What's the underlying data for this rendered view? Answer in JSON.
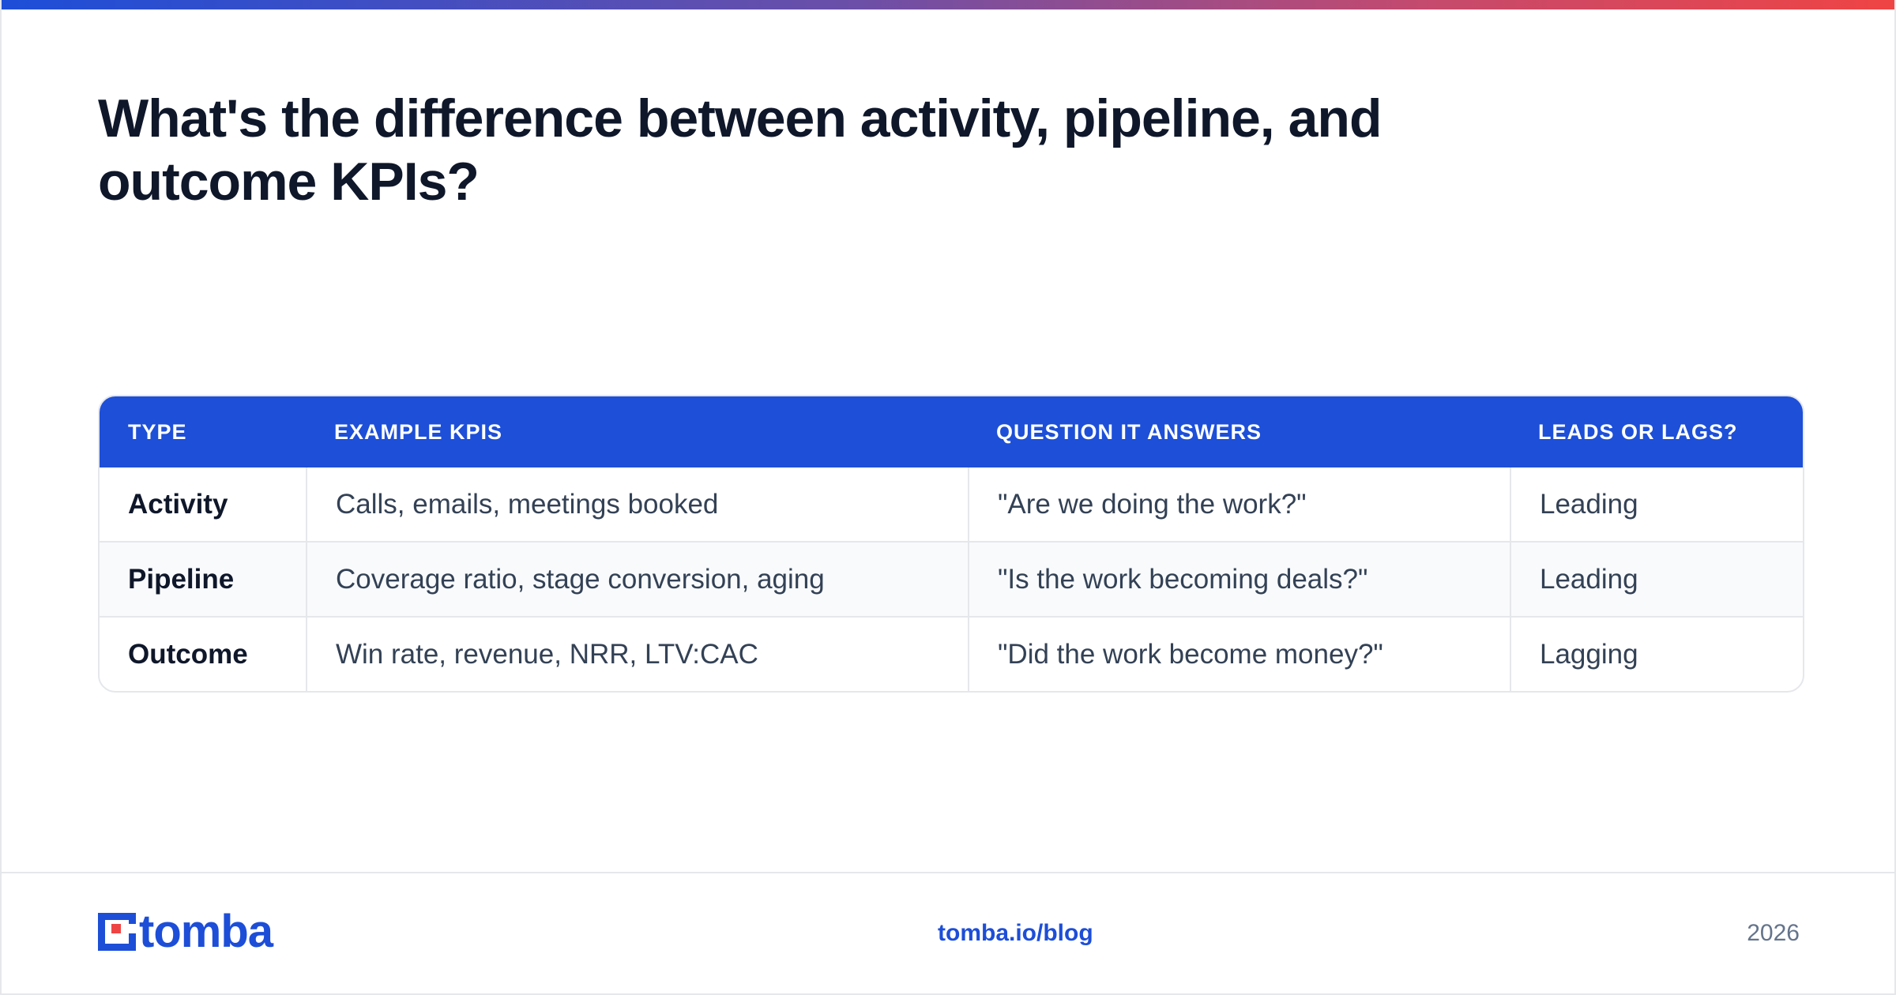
{
  "title": "What's the difference between activity, pipeline, and outcome KPIs?",
  "table": {
    "headers": [
      "TYPE",
      "EXAMPLE KPIS",
      "QUESTION IT ANSWERS",
      "LEADS OR LAGS?"
    ],
    "rows": [
      [
        "Activity",
        "Calls, emails, meetings booked",
        "\"Are we doing the work?\"",
        "Leading"
      ],
      [
        "Pipeline",
        "Coverage ratio, stage conversion, aging",
        "\"Is the work becoming deals?\"",
        "Leading"
      ],
      [
        "Outcome",
        "Win rate, revenue, NRR, LTV:CAC",
        "\"Did the work become money?\"",
        "Lagging"
      ]
    ]
  },
  "footer": {
    "logo_text": "tomba",
    "link": "tomba.io/blog",
    "year": "2026"
  },
  "colors": {
    "brand_blue": "#1d4ed8",
    "brand_red": "#ef4444",
    "title": "#0f172a",
    "body_text": "#334155",
    "muted": "#64748b"
  },
  "icons": {
    "logo": "tomba-logo-mark"
  }
}
